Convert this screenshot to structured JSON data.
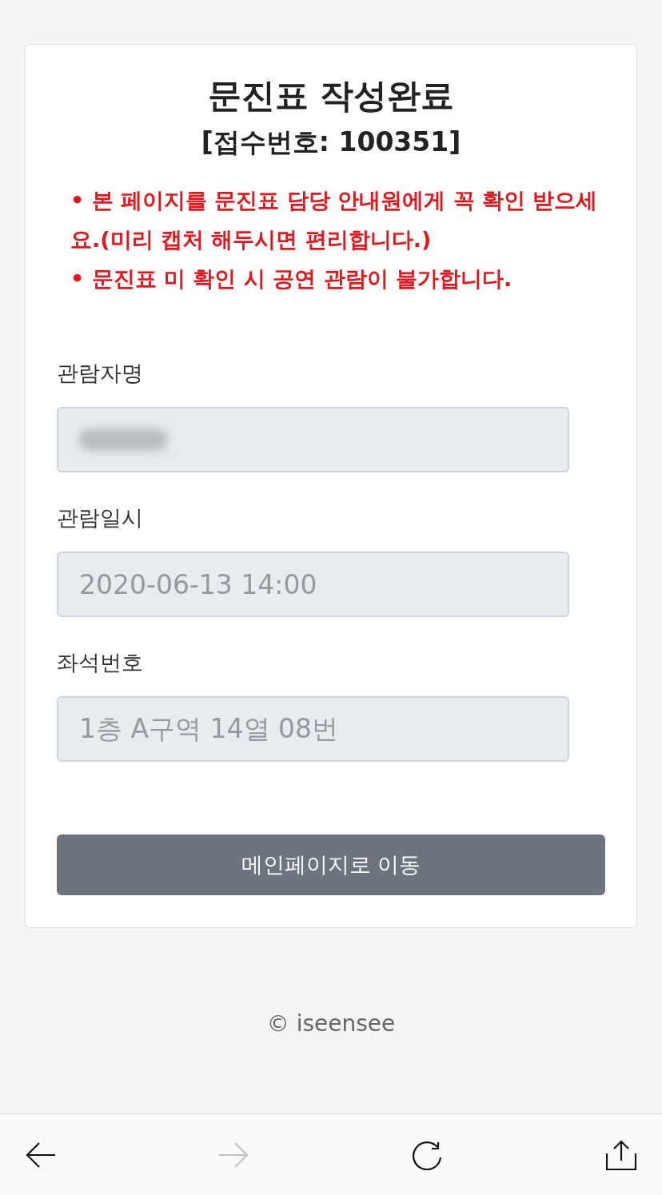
{
  "card": {
    "title": "문진표 작성완료",
    "receipt": "[접수번호: 100351]",
    "notices": [
      "• 본 페이지를 문진표 담당 안내원에게 꼭 확인 받으세요.(미리 캡처 해두시면 편리합니다.)",
      "• 문진표 미 확인 시 공연 관람이 불가합니다."
    ],
    "fields": [
      {
        "label": "관람자명",
        "redacted": true
      },
      {
        "label": "관람일시",
        "value": "2020-06-13 14:00",
        "redacted": false
      },
      {
        "label": "좌석번호",
        "value": "1층 A구역 14열 08번",
        "redacted": false
      }
    ],
    "button": "메인페이지로 이동"
  },
  "footer": "© iseensee",
  "toolbar": [
    {
      "kind": "back",
      "disabled": false
    },
    {
      "kind": "forward",
      "disabled": true
    },
    {
      "kind": "reload",
      "disabled": false
    },
    {
      "kind": "share",
      "disabled": false
    }
  ]
}
